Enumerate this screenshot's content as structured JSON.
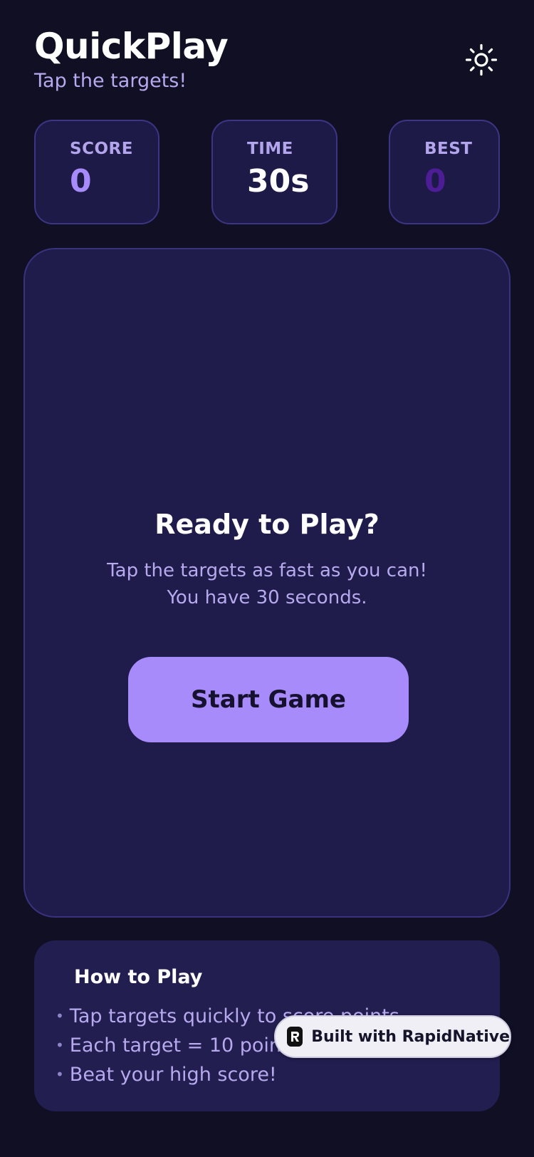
{
  "header": {
    "title": "QuickPlay",
    "subtitle": "Tap the targets!",
    "theme_icon": "sun-icon"
  },
  "stats": {
    "score": {
      "label": "SCORE",
      "value": "0"
    },
    "time": {
      "label": "TIME",
      "value": "30s"
    },
    "best": {
      "label": "BEST",
      "value": "0"
    }
  },
  "game": {
    "title": "Ready to Play?",
    "description_line1": "Tap the targets as fast as you can!",
    "description_line2": "You have 30 seconds.",
    "start_label": "Start Game"
  },
  "how_to_play": {
    "title": "How to Play",
    "items": [
      "Tap targets quickly to score points",
      "Each target = 10 points",
      "Beat your high score!"
    ]
  },
  "badge": {
    "label": "Built with RapidNative",
    "logo_icon": "rapidnative-logo-icon"
  },
  "colors": {
    "background": "#110f24",
    "card": "#1e1a48",
    "accent": "#a78bfa",
    "muted_text": "#b7a9ee",
    "best_value": "#4c1d95"
  }
}
